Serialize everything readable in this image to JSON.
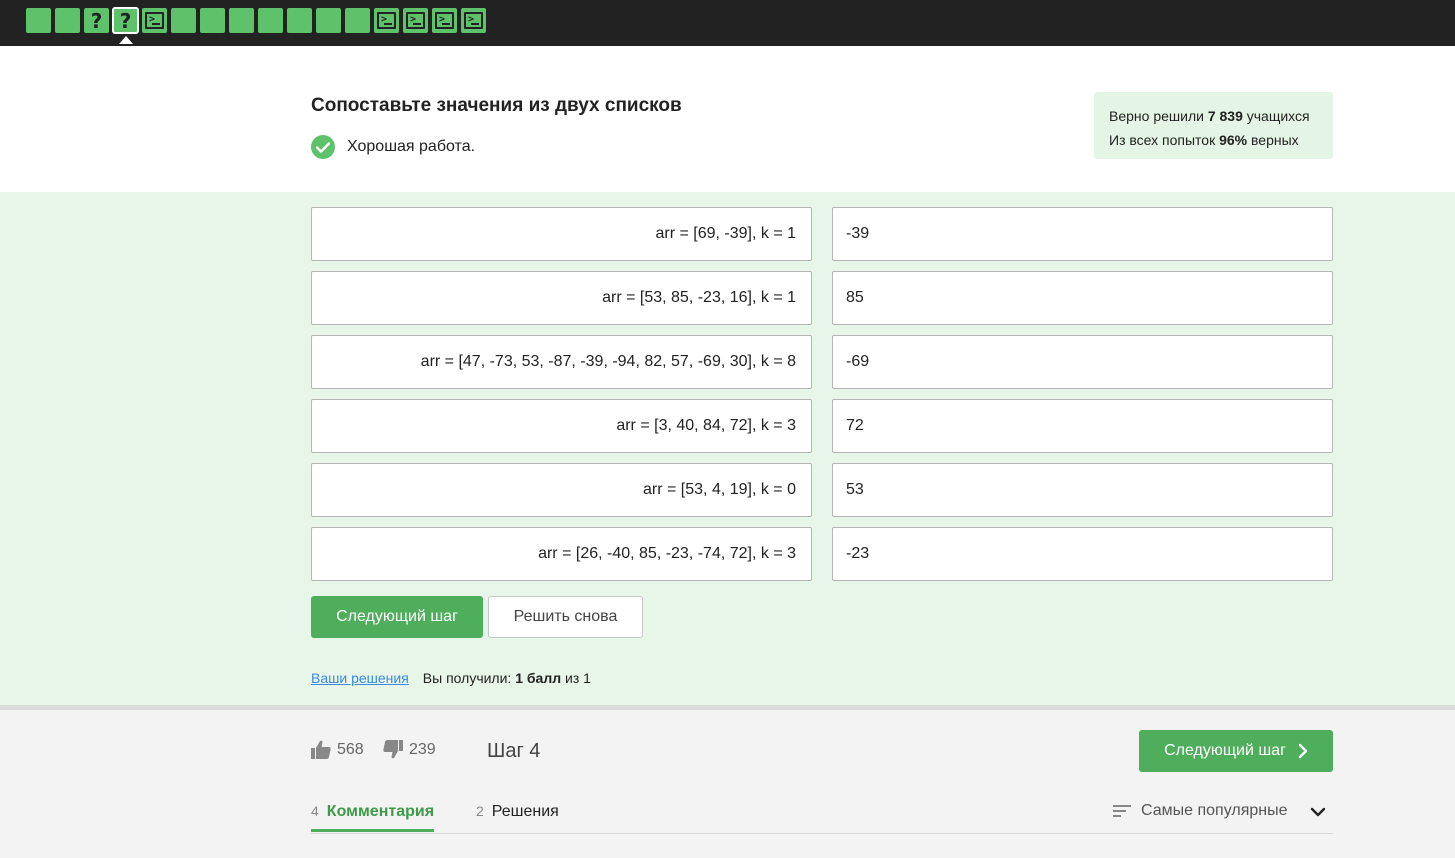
{
  "topbar": {
    "steps": [
      {
        "kind": "plain"
      },
      {
        "kind": "plain"
      },
      {
        "kind": "quiz",
        "glyph": "?"
      },
      {
        "kind": "quiz",
        "glyph": "?",
        "current": true
      },
      {
        "kind": "code"
      },
      {
        "kind": "plain"
      },
      {
        "kind": "plain"
      },
      {
        "kind": "plain"
      },
      {
        "kind": "plain"
      },
      {
        "kind": "plain"
      },
      {
        "kind": "plain"
      },
      {
        "kind": "plain"
      },
      {
        "kind": "code"
      },
      {
        "kind": "code"
      },
      {
        "kind": "code"
      },
      {
        "kind": "code"
      }
    ]
  },
  "header": {
    "title": "Сопоставьте значения из двух списков",
    "status": "Хорошая работа."
  },
  "stats": {
    "line1_prefix": "Верно решили ",
    "solved_count": "7 839",
    "line1_suffix": " учащихся",
    "line2_prefix": "Из всех попыток ",
    "percent": "96%",
    "line2_suffix": " верных"
  },
  "pairs": [
    {
      "left": "arr = [69, -39], k = 1",
      "right": "-39"
    },
    {
      "left": "arr = [53, 85, -23, 16], k = 1",
      "right": "85"
    },
    {
      "left": "arr = [47, -73, 53, -87, -39, -94, 82, 57, -69, 30], k = 8",
      "right": "-69"
    },
    {
      "left": "arr = [3, 40, 84, 72], k = 3",
      "right": "72"
    },
    {
      "left": "arr = [53, 4, 19], k = 0",
      "right": "53"
    },
    {
      "left": "arr = [26, -40, 85, -23, -74, 72], k = 3",
      "right": "-23"
    }
  ],
  "actions": {
    "next_label": "Следующий шаг",
    "again_label": "Решить снова"
  },
  "score": {
    "solutions_link": "Ваши решения",
    "got_prefix": "Вы получили: ",
    "points": "1 балл",
    "got_suffix": " из 1"
  },
  "footer": {
    "likes": "568",
    "dislikes": "239",
    "step_label": "Шаг 4",
    "next_label": "Следующий шаг",
    "tabs": [
      {
        "count": "4",
        "label": "Комментария",
        "active": true
      },
      {
        "count": "2",
        "label": "Решения",
        "active": false
      }
    ],
    "sort_label": "Самые популярные"
  },
  "colors": {
    "accent": "#4fae5c",
    "step_green": "#5ec26a",
    "quiz_bg": "#e8f6e9",
    "topbar_bg": "#222222"
  }
}
